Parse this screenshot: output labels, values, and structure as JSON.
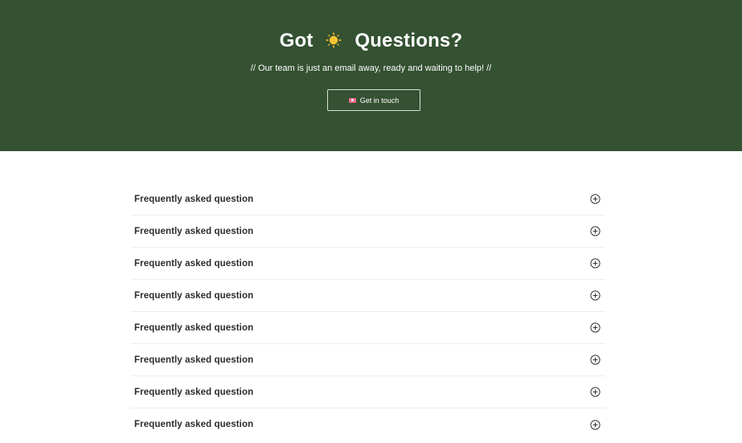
{
  "hero": {
    "title_before": "Got",
    "title_icon": "sun-icon",
    "title_after": "Questions?",
    "subtitle": "// Our team is just an email away, ready and waiting to help! //",
    "cta_label": "Get in touch",
    "cta_icon": "envelope-icon",
    "background_color": "#345132"
  },
  "faq": {
    "expand_icon": "plus-circle-icon",
    "items": [
      {
        "question": "Frequently asked question"
      },
      {
        "question": "Frequently asked question"
      },
      {
        "question": "Frequently asked question"
      },
      {
        "question": "Frequently asked question"
      },
      {
        "question": "Frequently asked question"
      },
      {
        "question": "Frequently asked question"
      },
      {
        "question": "Frequently asked question"
      },
      {
        "question": "Frequently asked question"
      }
    ]
  }
}
